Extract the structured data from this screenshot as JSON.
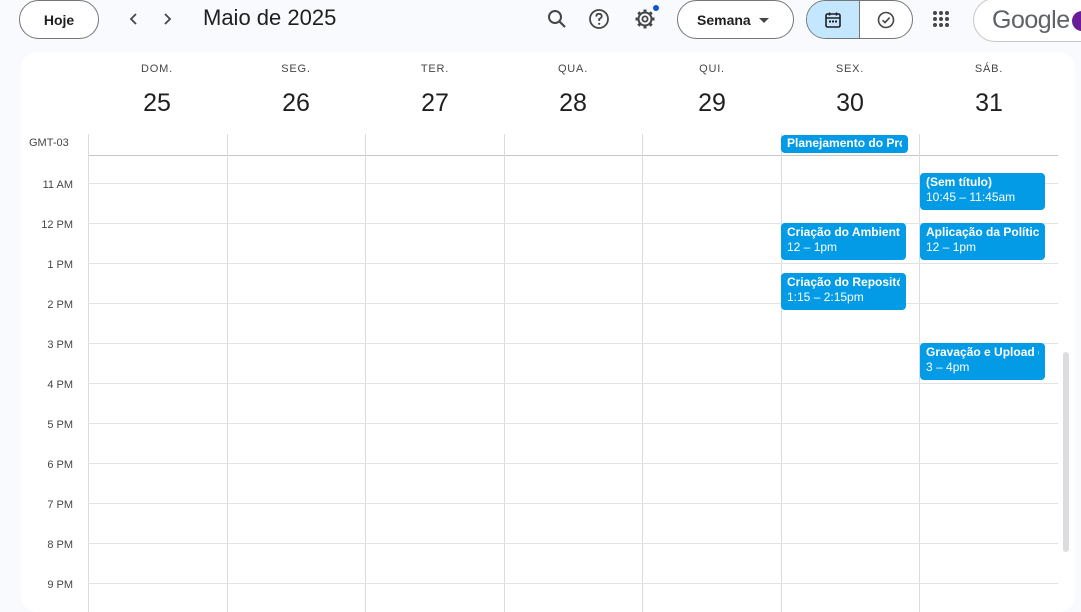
{
  "header": {
    "today_label": "Hoje",
    "month_title": "Maio de 2025",
    "view_label": "Semana",
    "brand": "Google"
  },
  "icons": {
    "prev": "chevron-left-icon",
    "next": "chevron-right-icon",
    "search": "search-icon",
    "help": "help-icon",
    "settings": "gear-icon",
    "calendar_view": "calendar-icon",
    "tasks_view": "task-check-icon",
    "apps": "apps-grid-icon"
  },
  "colors": {
    "event": "#039be5",
    "segment_active": "#c2e7ff",
    "notification": "#0b57d0"
  },
  "days": [
    {
      "name": "DOM.",
      "num": "25"
    },
    {
      "name": "SEG.",
      "num": "26"
    },
    {
      "name": "TER.",
      "num": "27"
    },
    {
      "name": "QUA.",
      "num": "28"
    },
    {
      "name": "QUI.",
      "num": "29"
    },
    {
      "name": "SEX.",
      "num": "30"
    },
    {
      "name": "SÁB.",
      "num": "31"
    }
  ],
  "timezone": "GMT-03",
  "hours": [
    "11 AM",
    "12 PM",
    "1 PM",
    "2 PM",
    "3 PM",
    "4 PM",
    "5 PM",
    "6 PM",
    "7 PM",
    "8 PM",
    "9 PM"
  ],
  "events": [
    {
      "title": "Planejamento do Pro",
      "time": ""
    },
    {
      "title": "(Sem título)",
      "time": "10:45 – 11:45am"
    },
    {
      "title": "Criação do Ambiente",
      "time": "12 – 1pm"
    },
    {
      "title": "Aplicação da Política",
      "time": "12 – 1pm"
    },
    {
      "title": "Criação do Repositór",
      "time": "1:15 – 2:15pm"
    },
    {
      "title": "Gravação e Upload d",
      "time": "3 – 4pm"
    }
  ]
}
